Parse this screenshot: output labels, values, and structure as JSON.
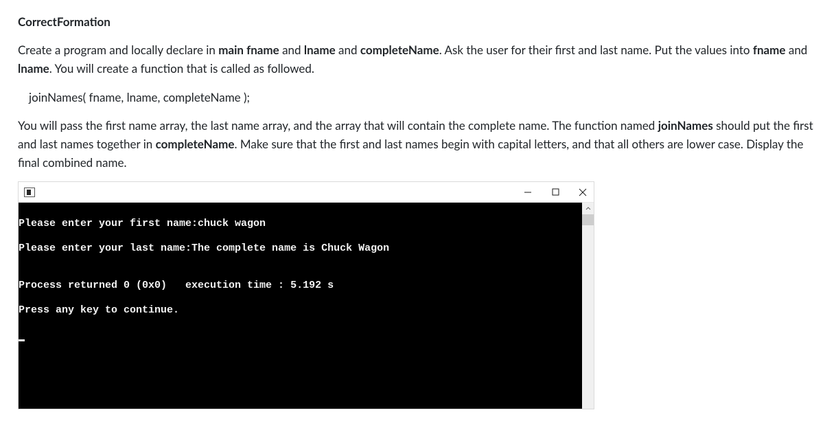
{
  "title": "CorrectFormation",
  "para1_a": "Create a program and locally declare in ",
  "para1_b1": "main fname",
  "para1_c": " and ",
  "para1_b2": "lname",
  "para1_d": " and ",
  "para1_b3": "completeName",
  "para1_e": ". Ask the user for their first and last name. Put the values into ",
  "para1_b4": "fname",
  "para1_f": " and ",
  "para1_b5": "lname",
  "para1_g": ". You will create a function that is called as followed.",
  "code_line": "joinNames( fname, lname, completeName );",
  "para2_a": "You will pass the first name array, the last name array, and the array that will contain the complete name. The function named ",
  "para2_b1": "joinNames",
  "para2_c": " should put the first and last names together in ",
  "para2_b2": "completeName",
  "para2_d": ". Make sure that the first and last names begin with capital letters, and that all others are lower case. Display the final combined name.",
  "console": {
    "line1": "Please enter your first name:chuck wagon",
    "line2": "Please enter your last name:The complete name is Chuck Wagon",
    "blank": "",
    "line3": "Process returned 0 (0x0)   execution time : 5.192 s",
    "line4": "Press any key to continue."
  }
}
